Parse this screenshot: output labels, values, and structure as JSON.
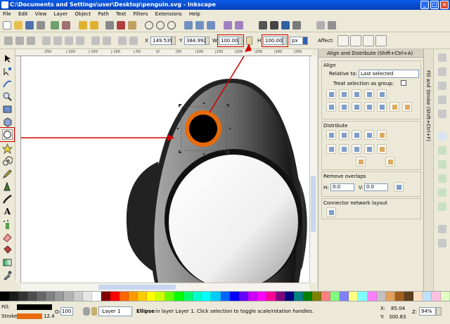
{
  "window": {
    "title": "C:\\Documents and Settings\\user\\Desktop\\penguin.svg - Inkscape",
    "minimize": "_",
    "maximize": "□",
    "close": "×"
  },
  "menu": [
    "File",
    "Edit",
    "View",
    "Layer",
    "Object",
    "Path",
    "Text",
    "Filters",
    "Extensions",
    "Help"
  ],
  "controls": {
    "x_label": "X",
    "x_value": "149.539",
    "y_label": "Y",
    "y_value": "384.992",
    "w_label": "W",
    "w_value": "100.000",
    "h_label": "H",
    "h_value": "100.000",
    "unit": "px",
    "affect_label": "Affect:"
  },
  "ruler_ticks": [
    "-250",
    "|-200",
    "|-150",
    "|-100",
    "|-50",
    "|0",
    "|50",
    "|100",
    "|150",
    "|200",
    "|250",
    "|300",
    "|350",
    "|400"
  ],
  "panel": {
    "title": "Align and Distribute (Shift+Ctrl+A)",
    "side_tab": "Fill and Stroke (Shift+Ctrl+F)",
    "align_title": "Align",
    "relative_label": "Relative to:",
    "relative_value": "Last selected",
    "group_label": "Treat selection as group:",
    "distribute_title": "Distribute",
    "overlap_title": "Remove overlaps",
    "h_label": "H:",
    "h_value": "0.0",
    "v_label": "V:",
    "v_value": "0.0",
    "connector_title": "Connector network layout"
  },
  "status": {
    "fill_label": "Fill:",
    "stroke_label": "Stroke:",
    "stroke_width": "12.4",
    "opacity_label": "O:",
    "opacity_value": "100",
    "layer": "·Layer 1",
    "message_strong": "Ellipse",
    "message_rest": " in layer Layer 1. Click selection to toggle scale/rotation handles.",
    "x_label": "X:",
    "x_value": "85.04",
    "y_label": "Y:",
    "y_value": "300.83",
    "z_label": "Z:",
    "z_value": "94%"
  },
  "colors": {
    "accent_red": "#d10000",
    "selected_ring": "#e86a0a",
    "palette": [
      "#000000",
      "#1a1a1a",
      "#333333",
      "#4d4d4d",
      "#666666",
      "#808080",
      "#999999",
      "#b3b3b3",
      "#cccccc",
      "#e6e6e6",
      "#ffffff",
      "#800000",
      "#ff0000",
      "#ff6600",
      "#ff9900",
      "#ffcc00",
      "#ffff00",
      "#ccff00",
      "#66ff00",
      "#00ff00",
      "#00ff66",
      "#00ffcc",
      "#00ffff",
      "#00ccff",
      "#0066ff",
      "#0000ff",
      "#6600ff",
      "#cc00ff",
      "#ff00ff",
      "#ff0099",
      "#800080",
      "#000080",
      "#008080",
      "#008000",
      "#808000",
      "#ff8080",
      "#80ff80",
      "#8080ff",
      "#ffff80",
      "#80ffff",
      "#ff80ff",
      "#c0c0c0",
      "#e0a060",
      "#a06020",
      "#604020",
      "#ffe0c0",
      "#c0e0ff",
      "#ffc0e0",
      "#e0ffc0"
    ]
  }
}
